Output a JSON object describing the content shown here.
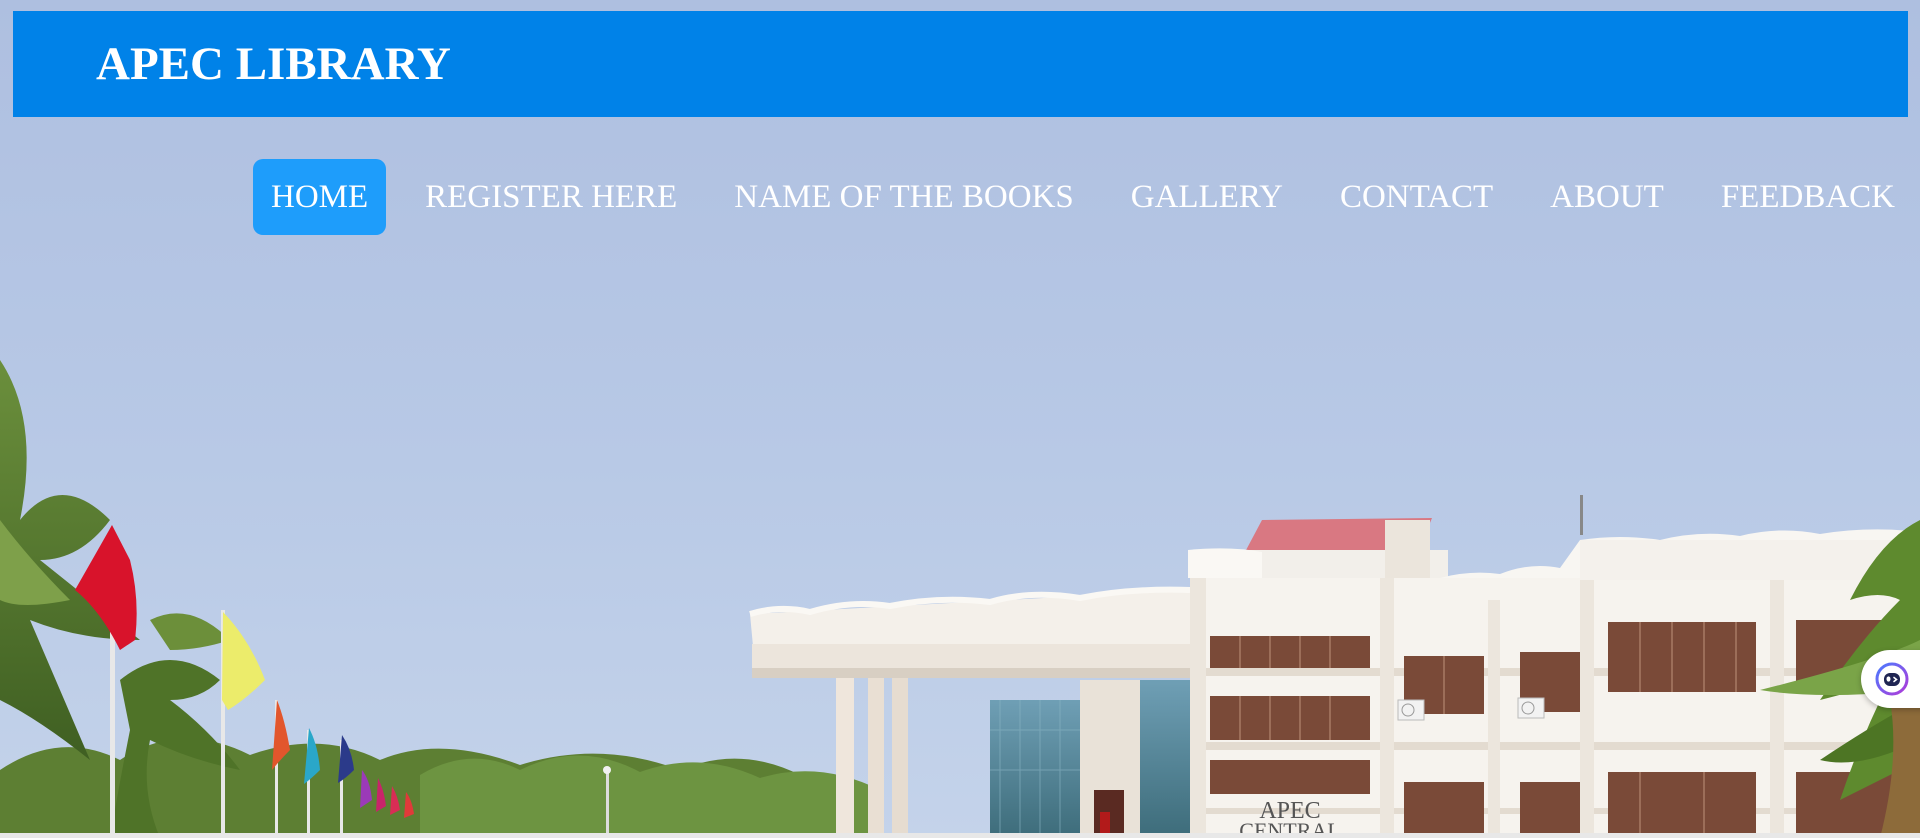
{
  "header": {
    "title": "APEC LIBRARY",
    "background_color": "#0082e8"
  },
  "nav": {
    "active_color": "#1e9dfb",
    "items": [
      {
        "label": "HOME",
        "active": true
      },
      {
        "label": "REGISTER HERE",
        "active": false
      },
      {
        "label": "NAME OF THE BOOKS",
        "active": false
      },
      {
        "label": "GALLERY",
        "active": false
      },
      {
        "label": "CONTACT",
        "active": false
      },
      {
        "label": "ABOUT",
        "active": false
      },
      {
        "label": "FEEDBACK",
        "active": false
      }
    ]
  },
  "hero": {
    "building_sign_line1": "APEC",
    "building_sign_line2": "CENTRAL"
  },
  "widget": {
    "icon": "assistant-face-icon"
  }
}
